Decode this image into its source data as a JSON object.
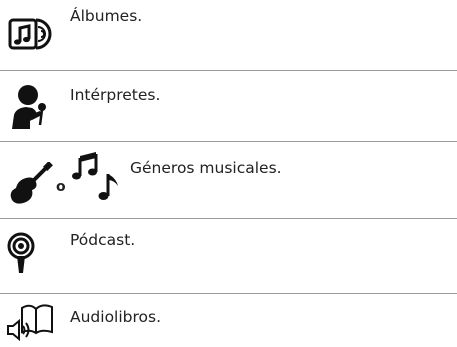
{
  "menu": {
    "items": [
      {
        "label": "Álbumes.",
        "icon": "album-disc-icon"
      },
      {
        "label": "Intérpretes.",
        "icon": "singer-microphone-icon"
      },
      {
        "label": "Géneros musicales.",
        "icon": "guitar-music-notes-icon",
        "icon_text": "o"
      },
      {
        "label": "Pódcast.",
        "icon": "podcast-icon"
      },
      {
        "label": "Audiolibros.",
        "icon": "audiobook-icon"
      }
    ]
  },
  "colors": {
    "text": "#222222",
    "icon": "#111111",
    "divider": "#9a9a9a",
    "background": "#ffffff"
  }
}
